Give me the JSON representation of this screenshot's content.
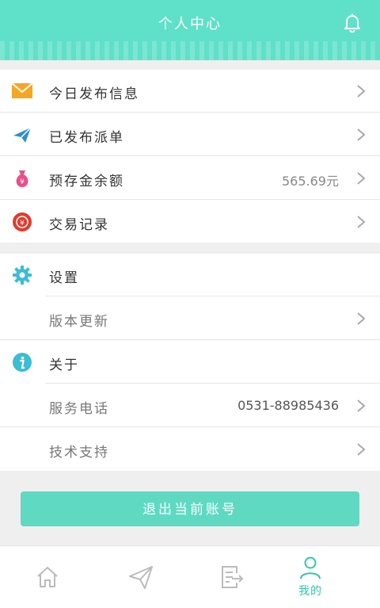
{
  "header": {
    "title": "个人中心",
    "bell_icon": "bell-icon"
  },
  "group1": [
    {
      "label": "今日发布信息",
      "icon": "envelope-icon",
      "value": ""
    },
    {
      "label": "已发布派单",
      "icon": "paper-plane-icon",
      "value": ""
    },
    {
      "label": "预存金余额",
      "icon": "money-bag-icon",
      "value": "565.69元"
    },
    {
      "label": "交易记录",
      "icon": "transaction-record-icon",
      "value": ""
    }
  ],
  "group2": {
    "settings_label": "设置",
    "version_update_label": "版本更新",
    "about_label": "关于",
    "service_phone_label": "服务电话",
    "service_phone_value": "0531-88985436",
    "tech_support_label": "技术支持"
  },
  "logout_label": "退出当前账号",
  "tabbar": {
    "tabs": [
      {
        "icon": "home-icon",
        "label": ""
      },
      {
        "icon": "send-icon",
        "label": ""
      },
      {
        "icon": "orders-icon",
        "label": ""
      },
      {
        "icon": "user-icon",
        "label": "我的"
      }
    ]
  },
  "colors": {
    "accent": "#5fe0c8",
    "active_tab": "#2ec7ad"
  }
}
